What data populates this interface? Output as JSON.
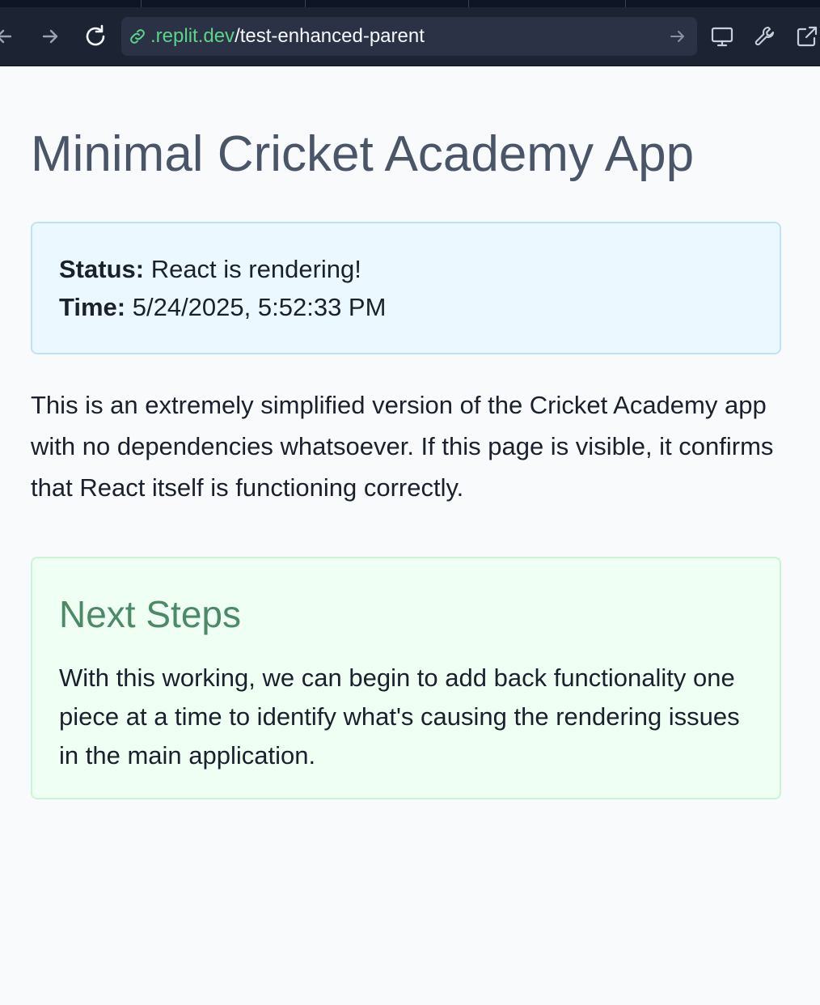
{
  "browser": {
    "url_domain": ".replit.dev",
    "url_path": "/test-enhanced-parent",
    "icons": {
      "back": "arrow-left-icon",
      "forward": "arrow-right-icon",
      "reload": "reload-icon",
      "link": "link-icon",
      "go": "arrow-right-icon",
      "devices": "monitor-icon",
      "devtools": "wrench-icon",
      "external": "external-link-icon"
    }
  },
  "page": {
    "title": "Minimal Cricket Academy App",
    "status": {
      "status_label": "Status:",
      "status_value": " React is rendering!",
      "time_label": "Time:",
      "time_value": " 5/24/2025, 5:52:33 PM"
    },
    "description": "This is an extremely simplified version of the Cricket Academy app with no dependencies whatsoever. If this page is visible, it confirms that React itself is functioning correctly.",
    "next_steps": {
      "heading": "Next Steps",
      "text": "With this working, we can begin to add back functionality one piece at a time to identify what's causing the rendering issues in the main application."
    }
  },
  "colors": {
    "chrome_bg": "#1c2333",
    "urlbar_bg": "#2b3245",
    "url_domain": "#5bd48a",
    "status_bg": "#ebf8ff",
    "status_border": "#bee3f8",
    "next_bg": "#f0fff4",
    "next_border": "#c6f6d5",
    "next_heading": "#4a8a66"
  }
}
